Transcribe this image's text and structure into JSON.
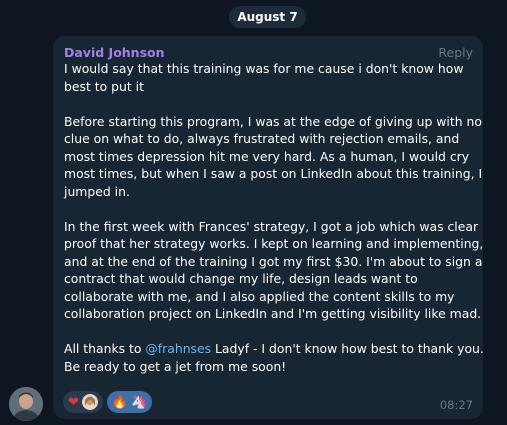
{
  "date_separator": "August 7",
  "message": {
    "sender": "David Johnson",
    "reply_label": "Reply",
    "paragraphs": {
      "p1": "I would say that this training was for me cause i don't know how best to put it",
      "p2": "Before starting this program, I was at the edge of giving up with no clue on what to do, always frustrated with rejection emails, and most times depression hit me very hard. As a human, I would cry most times, but when I saw a post on LinkedIn about this training, I jumped in.",
      "p3": "In the first week with Frances' strategy, I got a job which was clear proof that her strategy works. I kept on learning and implementing, and at the end of the training I got my first $30. I'm about to sign a contract that would change my life, design leads want to collaborate with me, and I also applied the content skills to my collaboration project on LinkedIn and I'm getting visibility like mad.",
      "p4_prefix": "All thanks to ",
      "p4_mention": "@frahnses",
      "p4_suffix": " Ladyf - I don't know how best to thank you. Be ready to get a jet from me soon!"
    },
    "reactions": [
      {
        "emoji": "❤",
        "icon": "red-heart-icon"
      },
      {
        "emoji": "🔥",
        "icon": "fire-icon"
      },
      {
        "emoji": "🦄",
        "icon": "unicorn-icon"
      }
    ],
    "time": "08:27"
  },
  "colors": {
    "background": "#0e1621",
    "bubble": "#182533",
    "sender_name": "#9e83e7",
    "mention": "#6ab3f3",
    "muted": "#6c7883",
    "own_reaction": "#3e6fa8"
  }
}
